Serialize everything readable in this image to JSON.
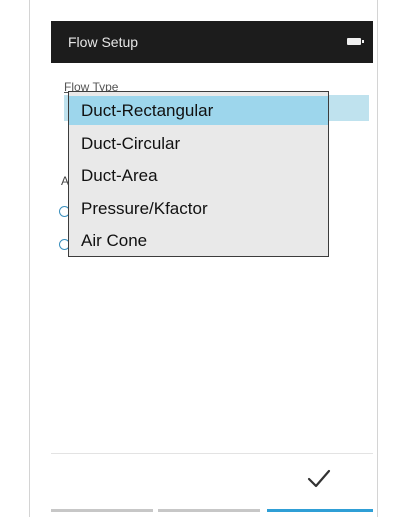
{
  "header": {
    "title": "Flow Setup",
    "battery_icon": "battery-icon"
  },
  "form": {
    "flow_type_label": "Flow Type",
    "partial_label_letter": "A"
  },
  "dropdown": {
    "selected_index": 0,
    "options": [
      "Duct-Rectangular",
      "Duct-Circular",
      "Duct-Area",
      "Pressure/Kfactor",
      "Air Cone"
    ]
  },
  "footer": {
    "confirm_icon": "checkmark-icon",
    "active_tab_index": 2
  },
  "colors": {
    "title_bar": "#1c1c1c",
    "selected_option": "#9dd6ec",
    "field_highlight": "#bfe2ee",
    "accent": "#2f9fd6"
  }
}
